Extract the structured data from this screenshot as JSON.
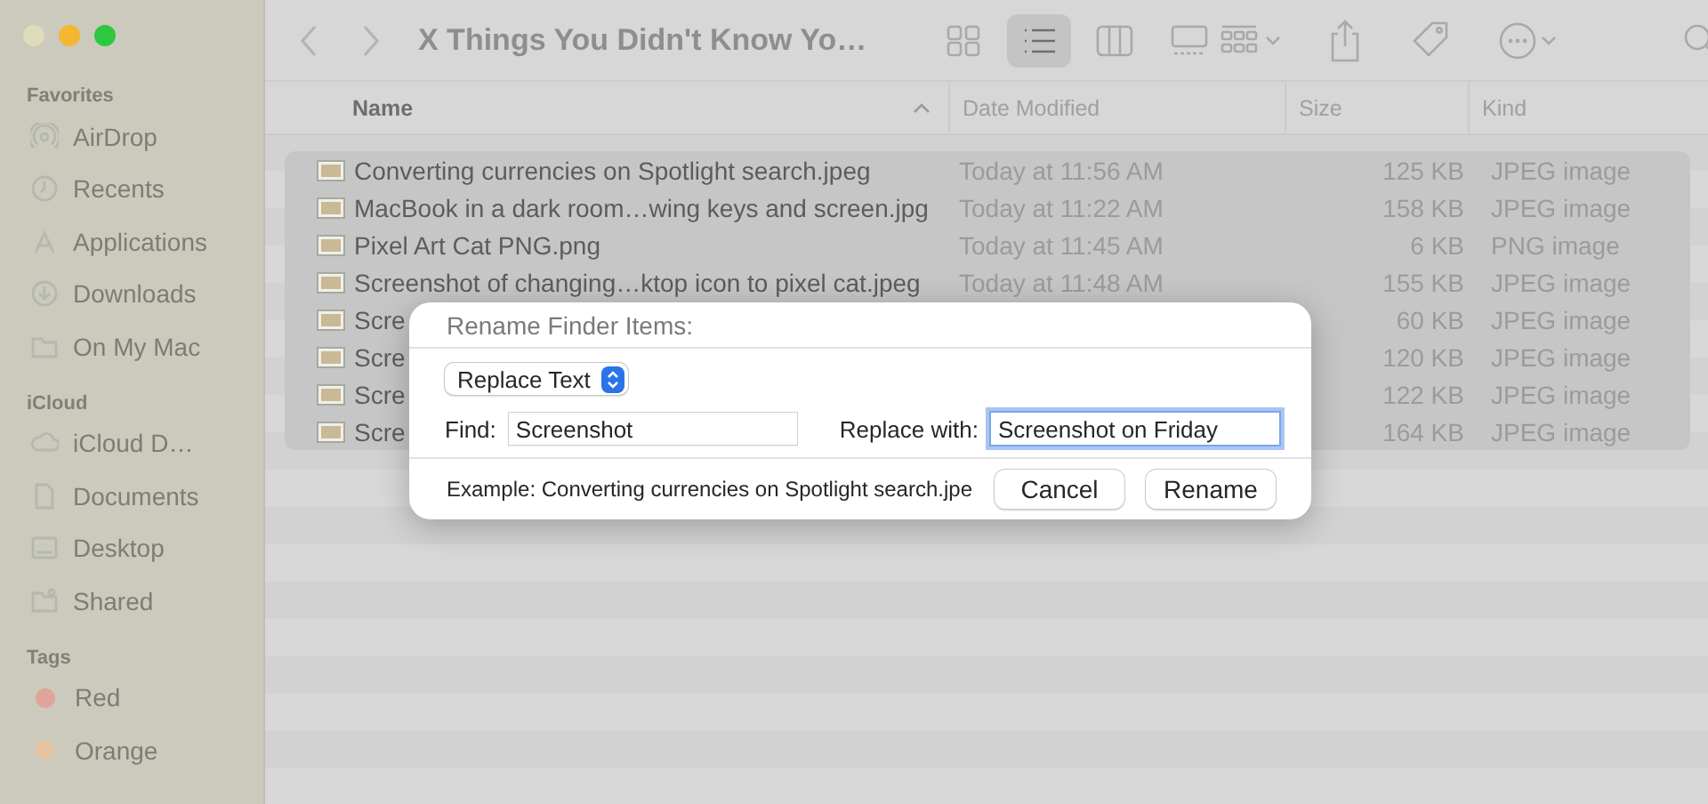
{
  "window": {
    "title": "X Things You Didn't Know Yo…"
  },
  "toolbar": {
    "views": [
      {
        "kind": "icons",
        "selected": false
      },
      {
        "kind": "list",
        "selected": true
      },
      {
        "kind": "columns",
        "selected": false
      },
      {
        "kind": "gallery",
        "selected": false
      }
    ]
  },
  "sidebar": {
    "sections": [
      {
        "heading": "Favorites",
        "kind": "places",
        "items": [
          {
            "label": "AirDrop"
          },
          {
            "label": "Recents"
          },
          {
            "label": "Applications"
          },
          {
            "label": "Downloads"
          },
          {
            "label": "On My Mac"
          }
        ]
      },
      {
        "heading": "iCloud",
        "kind": "places",
        "items": [
          {
            "label": "iCloud D…"
          },
          {
            "label": "Documents"
          },
          {
            "label": "Desktop"
          },
          {
            "label": "Shared"
          }
        ]
      },
      {
        "heading": "Tags",
        "kind": "tags",
        "items": [
          {
            "label": "Red",
            "color": "#e0a49a"
          },
          {
            "label": "Orange",
            "color": "#e3c3a0"
          }
        ]
      }
    ]
  },
  "table": {
    "columns": [
      "Name",
      "Date Modified",
      "Size",
      "Kind"
    ],
    "rows": [
      {
        "name": "Converting currencies on Spotlight search.jpeg",
        "date": "Today at 11:56 AM",
        "size": "125 KB",
        "kind": "JPEG image",
        "selected": true
      },
      {
        "name": "MacBook in a dark room…wing keys and screen.jpg",
        "date": "Today at 11:22 AM",
        "size": "158 KB",
        "kind": "JPEG image",
        "selected": true
      },
      {
        "name": "Pixel Art Cat PNG.png",
        "date": "Today at 11:45 AM",
        "size": "6 KB",
        "kind": "PNG image",
        "selected": true
      },
      {
        "name": "Screenshot of changing…ktop icon to pixel cat.jpeg",
        "date": "Today at 11:48 AM",
        "size": "155 KB",
        "kind": "JPEG image",
        "selected": true
      },
      {
        "name": "Scre",
        "size": "60 KB",
        "kind": "JPEG image",
        "selected": true
      },
      {
        "name": "Scre",
        "size": "120 KB",
        "kind": "JPEG image",
        "selected": true
      },
      {
        "name": "Scre",
        "size": "122 KB",
        "kind": "JPEG image",
        "selected": true
      },
      {
        "name": "Scre",
        "size": "164 KB",
        "kind": "JPEG image",
        "selected": true
      }
    ]
  },
  "dialog": {
    "title": "Rename Finder Items:",
    "mode": "Replace Text",
    "find_label": "Find:",
    "find_value": "Screenshot",
    "replace_label": "Replace with:",
    "replace_value": "Screenshot on Friday",
    "replace_focused": true,
    "example": "Example: Converting currencies on Spotlight search.jpe",
    "buttons": [
      "Cancel",
      "Rename"
    ]
  }
}
